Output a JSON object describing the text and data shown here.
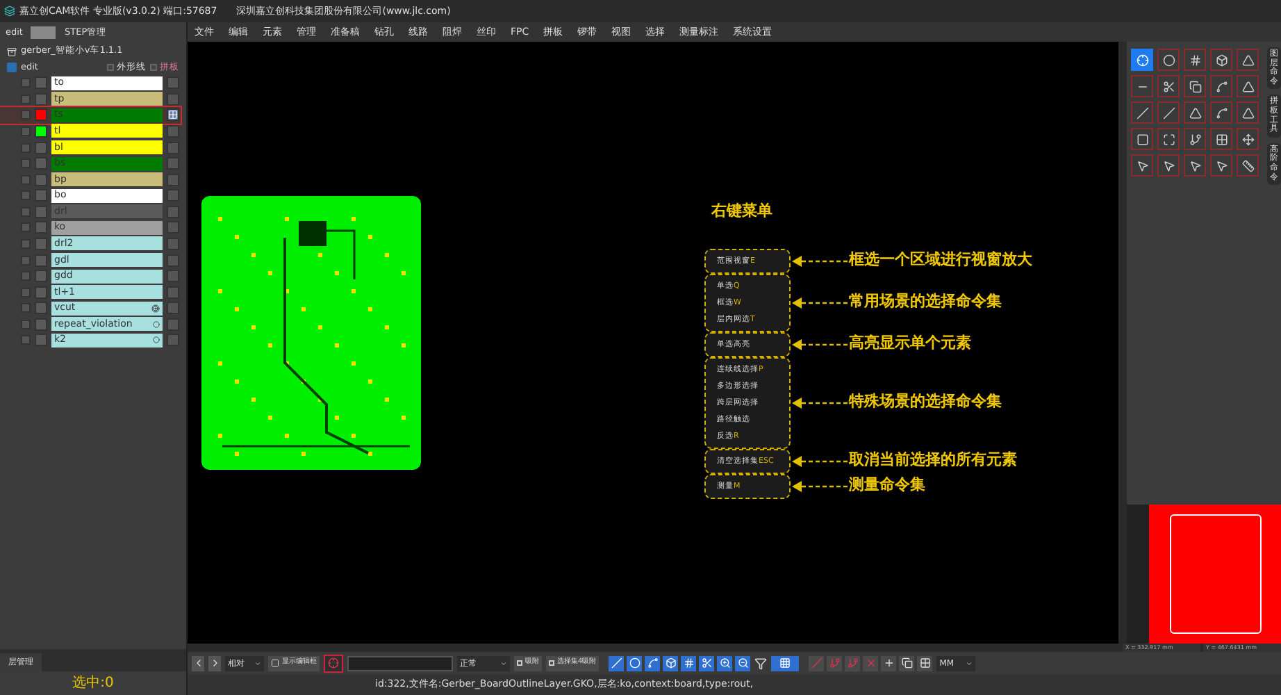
{
  "window": {
    "title": "嘉立创CAM软件 专业版(v3.0.2) 端口:57687",
    "company": "深圳嘉立创科技集团股份有限公司(www.jlc.com)"
  },
  "left_panel": {
    "step_label": "edit",
    "step_manager": "STEP管理",
    "job": "gerber_智能小v车1.1.1",
    "step": "edit",
    "options": [
      {
        "label": "外形线",
        "checked": false
      },
      {
        "label": "拼板",
        "checked": false
      }
    ],
    "layers": [
      {
        "name": "to",
        "color": "#ffffff",
        "selected": false,
        "kind": "plain"
      },
      {
        "name": "tp",
        "color": "#c8bd78",
        "selected": false,
        "kind": "plain"
      },
      {
        "name": "ts",
        "color": "#007a00",
        "swatch": {
          "color": "#ff0000"
        },
        "selected": true,
        "kind": "plain"
      },
      {
        "name": "tl",
        "color": "#ffff00",
        "swatch": {
          "color": "#00ff00"
        },
        "selected": false,
        "kind": "plain"
      },
      {
        "name": "bl",
        "color": "#ffff00",
        "selected": false,
        "kind": "plain"
      },
      {
        "name": "bs",
        "color": "#007a00",
        "selected": false,
        "kind": "plain"
      },
      {
        "name": "bp",
        "color": "#c8bd78",
        "selected": false,
        "kind": "plain"
      },
      {
        "name": "bo",
        "color": "#ffffff",
        "selected": false,
        "kind": "plain"
      },
      {
        "name": "drl",
        "color": "#5a5a5a",
        "selected": false,
        "kind": "plain"
      },
      {
        "name": "ko",
        "color": "#a0a0a0",
        "selected": false,
        "kind": "plain"
      },
      {
        "name": "drl2",
        "color": "#a8e0e0",
        "selected": false,
        "kind": "plain"
      },
      {
        "name": "gdl",
        "color": "#a8e0e0",
        "selected": false,
        "kind": "plain"
      },
      {
        "name": "gdd",
        "color": "#a8e0e0",
        "selected": false,
        "kind": "plain"
      },
      {
        "name": "tl+1",
        "color": "#a8e0e0",
        "selected": false,
        "kind": "plain"
      },
      {
        "name": "vcut",
        "color": "#a8e0e0",
        "selected": false,
        "kind": "target"
      },
      {
        "name": "repeat_violation",
        "color": "#a8e0e0",
        "selected": false,
        "kind": "ring"
      },
      {
        "name": "k2",
        "color": "#a8e0e0",
        "selected": false,
        "kind": "ring"
      }
    ],
    "tab": "层管理",
    "selection_count": "选中:0"
  },
  "menu": [
    "文件",
    "编辑",
    "元素",
    "管理",
    "准备稿",
    "钻孔",
    "线路",
    "阻焊",
    "丝印",
    "FPC",
    "拼板",
    "锣带",
    "视图",
    "选择",
    "测量标注",
    "系统设置"
  ],
  "canvas": {
    "title": "右键菜单",
    "groups": [
      {
        "items": [
          {
            "label": "范围视窗",
            "shortcut": "E"
          }
        ],
        "note": "框选一个区域进行视窗放大"
      },
      {
        "items": [
          {
            "label": "单选",
            "shortcut": "Q"
          },
          {
            "label": "框选",
            "shortcut": "W"
          },
          {
            "label": "层内网选",
            "shortcut": "T"
          }
        ],
        "note": "常用场景的选择命令集"
      },
      {
        "items": [
          {
            "label": "单选高亮"
          }
        ],
        "note": "高亮显示单个元素"
      },
      {
        "items": [
          {
            "label": "连续线选择",
            "shortcut": "P"
          },
          {
            "label": "多边形选择"
          },
          {
            "label": "跨层网选择"
          },
          {
            "label": "路径触选"
          },
          {
            "label": "反选",
            "shortcut": "R"
          }
        ],
        "note": "特殊场景的选择命令集"
      },
      {
        "items": [
          {
            "label": "清空选择集",
            "shortcut": "ESC"
          }
        ],
        "note": "取消当前选择的所有元素"
      },
      {
        "items": [
          {
            "label": "测量",
            "shortcut": "M"
          }
        ],
        "note": "测量命令集"
      }
    ]
  },
  "right_panel": {
    "tools": [
      {
        "selected": true
      },
      {
        "selected": false
      },
      {
        "selected": false
      },
      {
        "selected": false
      },
      {
        "selected": false
      },
      {
        "selected": false
      },
      {
        "selected": false
      },
      {
        "selected": false
      },
      {
        "selected": false
      },
      {
        "selected": false
      },
      {
        "selected": false
      },
      {
        "selected": false
      },
      {
        "selected": false
      },
      {
        "selected": false
      },
      {
        "selected": false
      },
      {
        "selected": false
      },
      {
        "selected": false
      },
      {
        "selected": false
      },
      {
        "selected": false
      },
      {
        "selected": false
      },
      {
        "selected": false
      },
      {
        "selected": false
      },
      {
        "selected": false
      },
      {
        "selected": false
      },
      {
        "selected": false
      }
    ],
    "side_tabs": [
      "图层命令",
      "拼板工具",
      "高阶命令"
    ],
    "coords": [
      "X = 332.917 mm",
      "Y = 467.6431 mm"
    ]
  },
  "toolbar": {
    "mode": "相对",
    "show_button": "显示编辑框",
    "layer_mode": "正常",
    "snap": {
      "label": "吸附",
      "checked": false
    },
    "selection_snap": {
      "label": "选择集4吸附",
      "checked": false
    },
    "unit": "MM"
  },
  "status_bar": "id:322,文件名:Gerber_BoardOutlineLayer.GKO,层名:ko,context:board,type:rout,"
}
